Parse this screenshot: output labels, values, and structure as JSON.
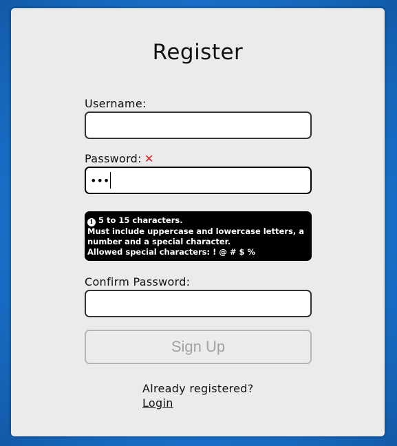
{
  "form": {
    "title": "Register",
    "username": {
      "label": "Username:",
      "value": ""
    },
    "password": {
      "label": "Password:",
      "invalid_mark": "✕",
      "masked_value": "•••"
    },
    "password_note": {
      "info_icon": "i",
      "lines": [
        "5 to 15 characters.",
        "Must include uppercase and lowercase letters, a",
        "number and a special character.",
        "Allowed special characters: ! @ # $ %"
      ]
    },
    "confirm_password": {
      "label": "Confirm Password:",
      "value": ""
    },
    "submit_label": "Sign Up",
    "already_registered_text": "Already registered?",
    "login_link_label": "Login"
  },
  "colors": {
    "background": "#1a73cf",
    "card": "#ebebeb",
    "invalid": "#e21b1b",
    "note_background": "#000000",
    "disabled_button_text": "#a3a3a3"
  },
  "icons": {
    "invalid": "x-mark-icon",
    "info": "info-circle-icon"
  }
}
